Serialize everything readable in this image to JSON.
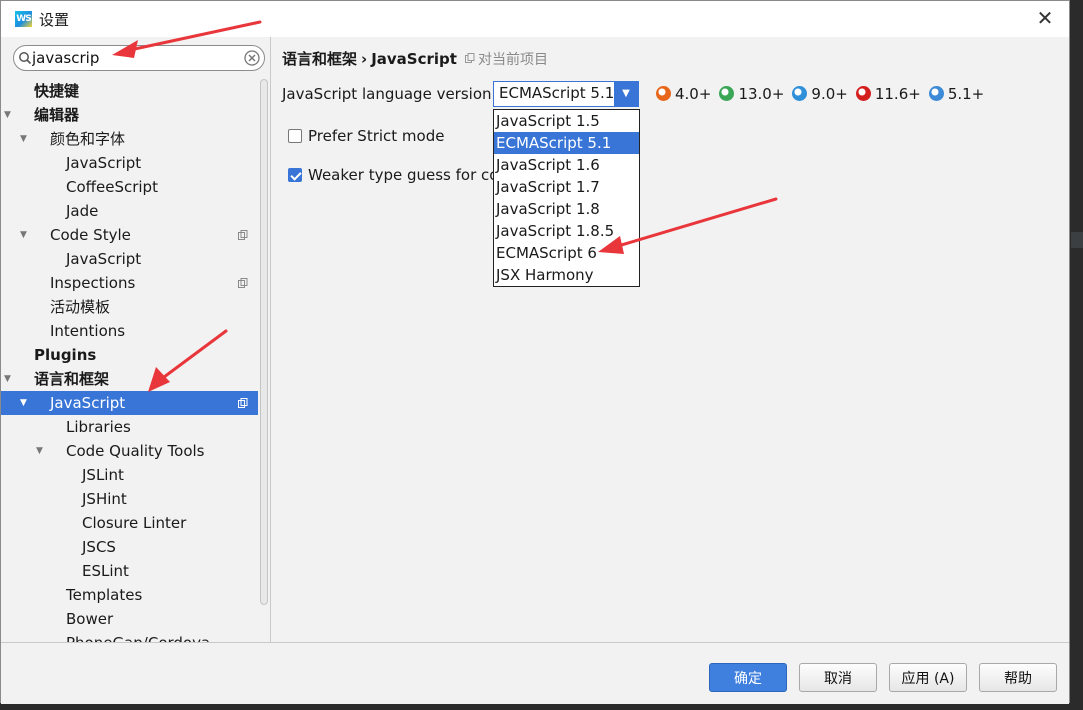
{
  "window": {
    "title": "设置",
    "logo_text": "WS",
    "close_glyph": "✕"
  },
  "search": {
    "value": "javascrip",
    "placeholder": ""
  },
  "tree": [
    {
      "label": "快捷键",
      "bold": true,
      "level": 0,
      "arrow": ""
    },
    {
      "label": "编辑器",
      "bold": true,
      "level": 0,
      "arrow": "▼"
    },
    {
      "label": "颜色和字体",
      "bold": false,
      "level": 1,
      "arrow": "▼"
    },
    {
      "label": "JavaScript",
      "bold": false,
      "level": 2,
      "arrow": ""
    },
    {
      "label": "CoffeeScript",
      "bold": false,
      "level": 2,
      "arrow": ""
    },
    {
      "label": "Jade",
      "bold": false,
      "level": 2,
      "arrow": ""
    },
    {
      "label": "Code Style",
      "bold": false,
      "level": 1,
      "arrow": "▼",
      "copy": true
    },
    {
      "label": "JavaScript",
      "bold": false,
      "level": 2,
      "arrow": ""
    },
    {
      "label": "Inspections",
      "bold": false,
      "level": 1,
      "arrow": "",
      "copy": true
    },
    {
      "label": "活动模板",
      "bold": false,
      "level": 1,
      "arrow": ""
    },
    {
      "label": "Intentions",
      "bold": false,
      "level": 1,
      "arrow": ""
    },
    {
      "label": "Plugins",
      "bold": true,
      "level": 0,
      "arrow": ""
    },
    {
      "label": "语言和框架",
      "bold": true,
      "level": 0,
      "arrow": "▼"
    },
    {
      "label": "JavaScript",
      "bold": false,
      "level": 1,
      "arrow": "▼",
      "copy": true,
      "selected": true
    },
    {
      "label": "Libraries",
      "bold": false,
      "level": 2,
      "arrow": ""
    },
    {
      "label": "Code Quality Tools",
      "bold": false,
      "level": 2,
      "arrow": "▼"
    },
    {
      "label": "JSLint",
      "bold": false,
      "level": 3,
      "arrow": ""
    },
    {
      "label": "JSHint",
      "bold": false,
      "level": 3,
      "arrow": ""
    },
    {
      "label": "Closure Linter",
      "bold": false,
      "level": 3,
      "arrow": ""
    },
    {
      "label": "JSCS",
      "bold": false,
      "level": 3,
      "arrow": ""
    },
    {
      "label": "ESLint",
      "bold": false,
      "level": 3,
      "arrow": ""
    },
    {
      "label": "Templates",
      "bold": false,
      "level": 2,
      "arrow": ""
    },
    {
      "label": "Bower",
      "bold": false,
      "level": 2,
      "arrow": ""
    },
    {
      "label": "PhoneGap/Cordova",
      "bold": false,
      "level": 2,
      "arrow": ""
    }
  ],
  "breadcrumb": {
    "section": "语言和框架",
    "separator": "›",
    "page": "JavaScript",
    "scope": "对当前项目"
  },
  "settings": {
    "language_version_label": "JavaScript language version",
    "language_version_value": "ECMAScript 5.1",
    "dropdown_arrow": "▼",
    "browsers": [
      {
        "icon": "firefox-icon",
        "version": "4.0+",
        "color": "#e8661a"
      },
      {
        "icon": "chrome-icon",
        "version": "13.0+",
        "color": "#3aa757"
      },
      {
        "icon": "ie-icon",
        "version": "9.0+",
        "color": "#2f8fd8"
      },
      {
        "icon": "opera-icon",
        "version": "11.6+",
        "color": "#d41f1f"
      },
      {
        "icon": "safari-icon",
        "version": "5.1+",
        "color": "#3d8ad6"
      }
    ],
    "prefer_strict_label": "Prefer Strict mode",
    "prefer_strict_checked": false,
    "weaker_type_label": "Weaker type guess for co",
    "weaker_type_checked": true,
    "options": [
      "JavaScript 1.5",
      "ECMAScript 5.1",
      "JavaScript 1.6",
      "JavaScript 1.7",
      "JavaScript 1.8",
      "JavaScript 1.8.5",
      "ECMAScript 6",
      "JSX Harmony"
    ],
    "selected_option_index": 1
  },
  "footer": {
    "ok_label": "确定",
    "cancel_label": "取消",
    "apply_label": "应用 (A)",
    "help_label": "帮助"
  },
  "colors": {
    "accent": "#3875d6",
    "annotation_arrow": "#e8363b"
  }
}
